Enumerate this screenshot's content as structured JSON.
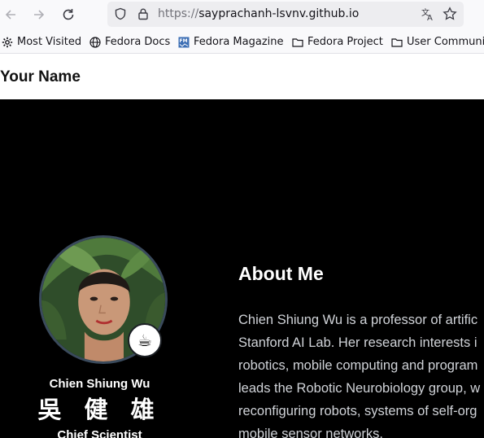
{
  "browser": {
    "url_scheme": "https://",
    "url_host": "sayprachanh-lsvnv.github.io",
    "icons": [
      "back-arrow-icon",
      "forward-arrow-icon",
      "reload-icon",
      "shield-icon",
      "lock-icon",
      "translate-icon",
      "bookmark-star-icon"
    ]
  },
  "bookmarks": [
    {
      "label": "Most Visited",
      "icon": "gear-icon"
    },
    {
      "label": "Fedora Docs",
      "icon": "globe-icon"
    },
    {
      "label": "Fedora Magazine",
      "icon": "fm-icon"
    },
    {
      "label": "Fedora Project",
      "icon": "folder-icon"
    },
    {
      "label": "User Communit",
      "icon": "folder-icon"
    }
  ],
  "header": {
    "site_title": "Your Name"
  },
  "profile": {
    "name": "Chien Shiung Wu",
    "name_cn": "吳 健 雄",
    "role": "Chief Scientist",
    "status_emoji": "☕"
  },
  "about": {
    "heading": "About Me",
    "lines": [
      "Chien Shiung Wu is a professor of artific",
      "Stanford AI Lab. Her research interests i",
      "robotics, mobile computing and program",
      "leads the Robotic Neurobiology group, w",
      "reconfiguring robots, systems of self-org",
      "mobile sensor networks."
    ]
  },
  "colors": {
    "hero_background": "#000000",
    "avatar_border": "#3a4a5c",
    "toolbar_background": "#f9f9fb",
    "urlbar_background": "#ededf0"
  }
}
